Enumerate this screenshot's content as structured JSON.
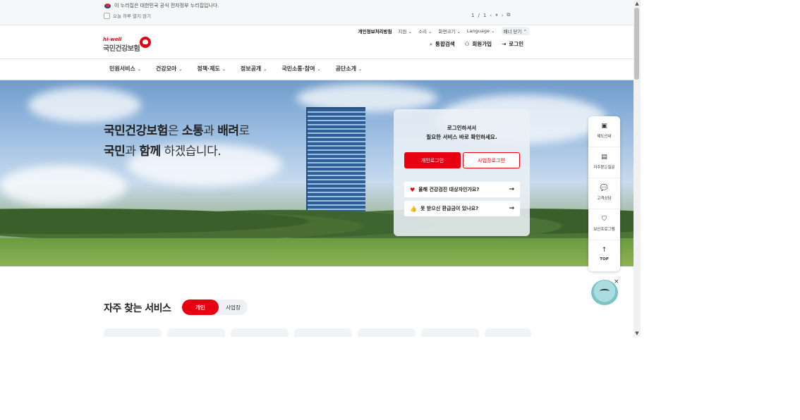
{
  "gov_banner": {
    "text": "이 누리집은 대한민국 공식 전자정부 누리집입니다.",
    "hide_today": "오늘 하루 열지 않기",
    "pager_current": "1",
    "pager_sep": "/",
    "pager_total": "1",
    "prev": "‹",
    "pause": "⏸",
    "next": "›",
    "expand": "⧉"
  },
  "logo": {
    "small": "hi-well",
    "main": "국민건강보험"
  },
  "util_menu": {
    "privacy": "개인정보처리방침",
    "support": "지원 ⌄",
    "sound": "소리 ⌄",
    "zoom": "화면크기 ⌄",
    "language": "Language ⌄",
    "close_banner": "배너 닫기 ⌃"
  },
  "actions": {
    "search": "통합검색",
    "search_icon": "⌕",
    "join": "회원가입",
    "join_icon": "⚇",
    "login": "로그인",
    "login_icon": "⇥"
  },
  "nav": {
    "items": [
      {
        "label": "민원서비스"
      },
      {
        "label": "건강모아"
      },
      {
        "label": "정책·제도"
      },
      {
        "label": "정보공개"
      },
      {
        "label": "국민소통·참여"
      },
      {
        "label": "공단소개"
      }
    ],
    "chev": "⌄"
  },
  "hero": {
    "line1_a": "국민건강보험",
    "line1_b": "은 ",
    "line1_c": "소통",
    "line1_d": "과 ",
    "line1_e": "배려",
    "line1_f": "로",
    "line2_a": "국민",
    "line2_b": "과 ",
    "line2_c": "함께",
    "line2_d": " 하겠습니다."
  },
  "login_card": {
    "title1": "로그인하셔서",
    "title2": "필요한 서비스 바로 확인하세요.",
    "personal_login": "개인로그인",
    "business_login": "사업장로그인",
    "link1": "올해 건강검진 대상자인가요?",
    "link1_icon": "♥",
    "link2": "못 받으신 환급금이 있나요?",
    "link2_icon": "👍",
    "arrow": "→"
  },
  "quick_menu": {
    "items": [
      {
        "label": "제도안내",
        "icon": "▣"
      },
      {
        "label": "자주묻는질문",
        "icon": "▤"
      },
      {
        "label": "고객상담",
        "icon": "💬"
      },
      {
        "label": "보안프로그램",
        "icon": "⛉"
      },
      {
        "label": "TOP",
        "icon": "↑"
      }
    ]
  },
  "chatbot": {
    "close": "×"
  },
  "services": {
    "title": "자주 찾는 서비스",
    "tab_personal": "개인",
    "tab_business": "사업장"
  },
  "scrollbar": {
    "up": "▲",
    "down": "▼"
  },
  "colors": {
    "brand_red": "#e60012"
  }
}
